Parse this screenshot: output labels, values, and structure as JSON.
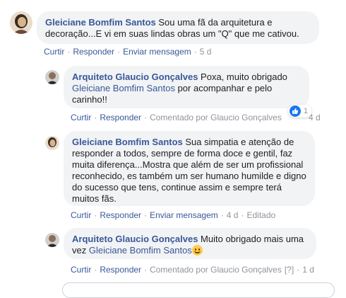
{
  "comments": [
    {
      "author": "Gleiciane Bomfim Santos",
      "text": " Sou uma fã da arquitetura e decoração...E vi em suas lindas obras um \"Q\" que me cativou.",
      "actions": {
        "reply": "Curtir",
        "respond": "Responder",
        "message": "Enviar mensagem",
        "time": "5 d"
      }
    },
    {
      "author": "Arquiteto Glaucio Gonçalves",
      "text_before": " Poxa, muito obrigado ",
      "mention": "Gleiciane Bomfim Santos",
      "text_after": " por acompanhar e pelo carinho!!",
      "reaction_count": "1",
      "actions": {
        "like": "Curtir",
        "respond": "Responder",
        "commented_by": "Comentado por Glaucio Gonçalves",
        "help": "[?]",
        "time": "4 d"
      }
    },
    {
      "author": "Gleiciane Bomfim Santos",
      "text": " Sua simpatia e atenção de responder a todos, sempre de forma doce e gentil, faz muita diferença...Mostra que além de ser um profissional reconhecido, es também um ser humano humilde e digno do sucesso que tens, continue assim e sempre terá muitos fãs.",
      "actions": {
        "like": "Curtir",
        "respond": "Responder",
        "message": "Enviar mensagem",
        "time": "4 d",
        "edited": "Editado"
      }
    },
    {
      "author": "Arquiteto Glaucio Gonçalves",
      "text_before": " Muito obrigado mais uma vez ",
      "mention": "Gleiciane Bomfim Santos",
      "actions": {
        "like": "Curtir",
        "respond": "Responder",
        "commented_by": "Comentado por Glaucio Gonçalves",
        "help": "[?]",
        "time": "1 d"
      }
    }
  ],
  "colors": {
    "link": "#385898",
    "bubble": "#f2f3f5",
    "meta": "#90949c",
    "like": "#1877f2"
  }
}
